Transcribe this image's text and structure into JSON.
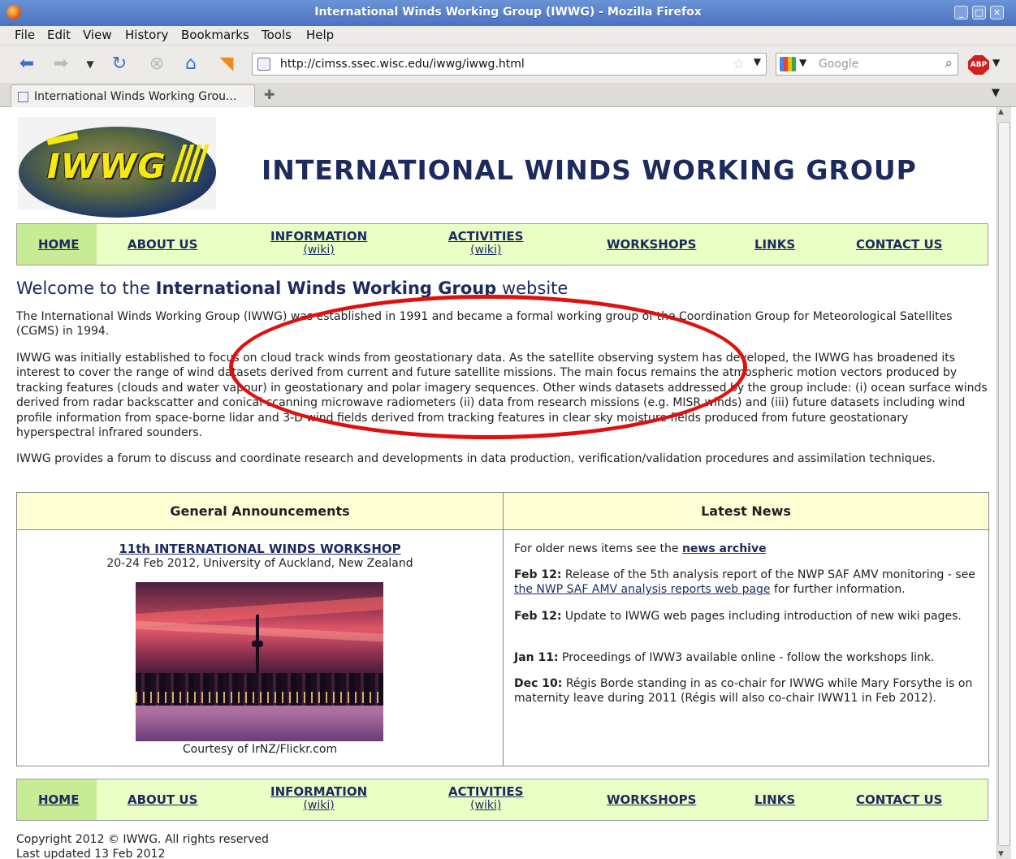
{
  "window": {
    "title": "International Winds Working Group (IWWG) - Mozilla Firefox",
    "controls": [
      "_",
      "□",
      "✕"
    ]
  },
  "menubar": {
    "items": [
      {
        "label": "File"
      },
      {
        "label": "Edit"
      },
      {
        "label": "View"
      },
      {
        "label": "History"
      },
      {
        "label": "Bookmarks"
      },
      {
        "label": "Tools"
      },
      {
        "label": "Help"
      }
    ]
  },
  "toolbar": {
    "url": "http://cimss.ssec.wisc.edu/iwwg/iwwg.html",
    "search_placeholder": "Google",
    "abp_label": "ABP"
  },
  "tabs": [
    {
      "label": "International Winds Working Grou..."
    }
  ],
  "page": {
    "logo_text": "IWWG",
    "heading": "INTERNATIONAL WINDS WORKING GROUP",
    "nav": {
      "home": "HOME",
      "about": "ABOUT US",
      "information": "INFORMATION",
      "information_wiki": "(wiki)",
      "activities": "ACTIVITIES",
      "activities_wiki": "(wiki)",
      "workshops": "WORKSHOPS",
      "links": "LINKS",
      "contact": "CONTACT US"
    },
    "welcome": {
      "prefix": "Welcome to the ",
      "bold": "International Winds Working Group",
      "suffix": " website"
    },
    "paragraphs": [
      "The International Winds Working Group (IWWG) was established in 1991 and became a formal working group of the Coordination Group for Meteorological Satellites (CGMS) in 1994.",
      "IWWG was initially established to focus on cloud track winds from geostationary data. As the satellite observing system has developed, the IWWG has broadened its interest to cover the range of wind datasets derived from current and future satellite missions. The main focus remains the atmospheric motion vectors produced by tracking features (clouds and water vapour) in geostationary and polar imagery sequences. Other winds datasets addressed by the group include: (i) ocean surface winds derived from radar backscatter and conical-scanning microwave radiometers (ii) data from research missions (e.g. MISR winds) and (iii) future datasets including wind profile information from space-borne lidar and 3-D wind fields derived from tracking features in clear sky moisture fields produced from future geostationary hyperspectral infrared sounders.",
      "IWWG provides a forum to discuss and coordinate research and developments in data production, verification/validation procedures and assimilation techniques."
    ],
    "announcements": {
      "header": "General Announcements",
      "workshop_title": "11th INTERNATIONAL WINDS WORKSHOP",
      "workshop_sub": "20-24 Feb 2012, University of Auckland, New Zealand",
      "photo_caption": "Courtesy of IrNZ/Flickr.com"
    },
    "news": {
      "header": "Latest News",
      "archive_prefix": "For older news items see the ",
      "archive_link": "news archive",
      "items": [
        {
          "date": "Feb 12:",
          "text_before": " Release of the 5th analysis report of the NWP SAF AMV monitoring - see ",
          "link": "the NWP SAF AMV analysis reports web page",
          "text_after": " for further information."
        },
        {
          "date": "Feb 12:",
          "text_before": " Update to IWWG web pages including introduction of new wiki pages.",
          "link": "",
          "text_after": ""
        },
        {
          "date": "Jan 11:",
          "text_before": " Proceedings of IWW3 available online - follow the workshops link.",
          "link": "",
          "text_after": ""
        },
        {
          "date": "Dec 10:",
          "text_before": " Régis Borde standing in as co-chair for IWWG while Mary Forsythe is on maternity leave during 2011 (Régis will also co-chair IWW11 in Feb 2012).",
          "link": "",
          "text_after": ""
        }
      ]
    },
    "footer": {
      "copyright": "Copyright 2012 © IWWG. All rights reserved",
      "updated": "Last updated 13 Feb 2012"
    }
  },
  "colors": {
    "nav_bg": "#eaffc5",
    "nav_home_bg": "#c8eb96",
    "box_header_bg": "#ffffd6",
    "heading": "#1d2a5e",
    "annotation": "#e01010"
  }
}
